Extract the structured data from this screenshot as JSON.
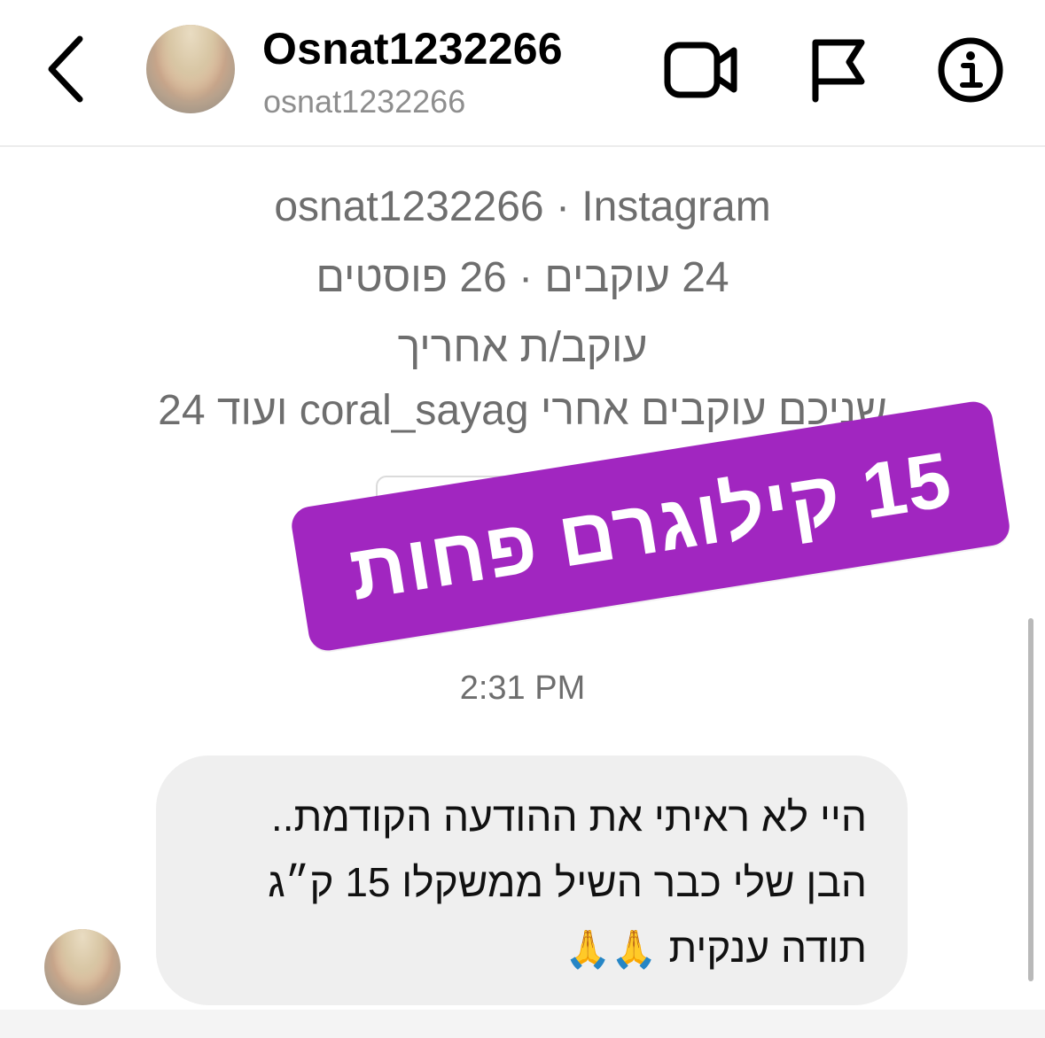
{
  "header": {
    "name": "Osnat1232266",
    "handle": "osnat1232266"
  },
  "profile_info": {
    "line1": "osnat1232266 · Instagram",
    "line2": "24 עוקבים · 26 פוסטים",
    "line3": "עוקב/ת אחריך",
    "line4": "שניכם עוקבים אחרי coral_sayag ועוד 24"
  },
  "sticker": {
    "text": "15 קילוגרם פחות",
    "color": "#a126c0"
  },
  "conversation": {
    "timestamp": "2:31 PM",
    "message": {
      "line1": "היי לא ראיתי את ההודעה הקודמת..",
      "line2": "הבן שלי כבר השיל ממשקלו 15 ק״ג",
      "line3": "תודה ענקית",
      "emoji": "🙏🙏"
    }
  },
  "icons": {
    "back": "chevron-left-icon",
    "video": "video-camera-icon",
    "flag": "flag-icon",
    "info": "info-icon"
  }
}
